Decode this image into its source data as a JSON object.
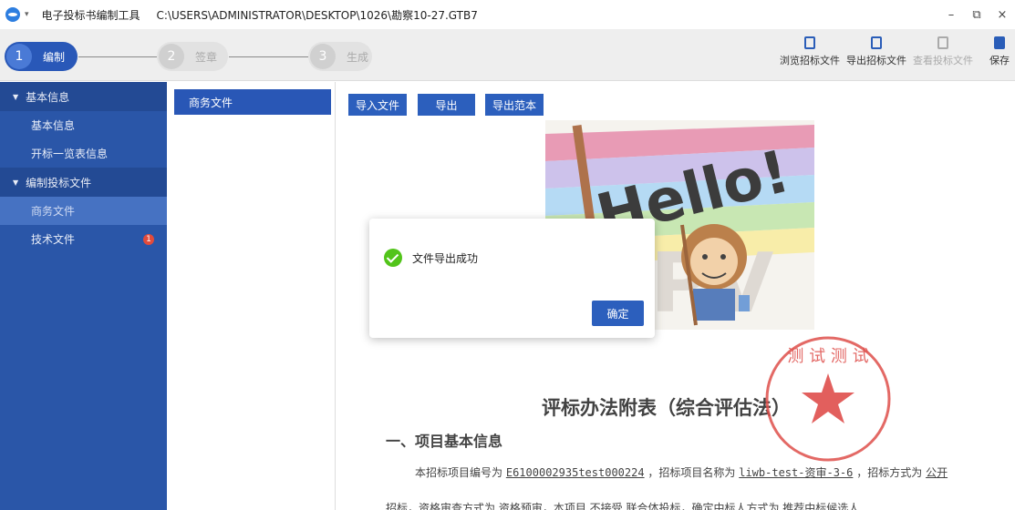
{
  "titlebar": {
    "app_name": "电子投标书编制工具",
    "file_path": "C:\\USERS\\ADMINISTRATOR\\DESKTOP\\1026\\勘察10-27.GTB7",
    "caret": "▾",
    "minimize": "–",
    "restore": "⧉",
    "close": "×"
  },
  "steps": [
    {
      "num": "1",
      "label": "编制"
    },
    {
      "num": "2",
      "label": "签章"
    },
    {
      "num": "3",
      "label": "生成"
    }
  ],
  "tools": {
    "browse": "浏览招标文件",
    "export": "导出招标文件",
    "view": "查看投标文件",
    "save": "保存"
  },
  "sidebar": {
    "groups": [
      {
        "label": "基本信息",
        "items": [
          "基本信息",
          "开标一览表信息"
        ]
      },
      {
        "label": "编制投标文件",
        "items": [
          "商务文件",
          "技术文件"
        ]
      }
    ],
    "badge": "1"
  },
  "file_list": {
    "selected": "商务文件"
  },
  "toolbar": {
    "import": "导入文件",
    "export": "导出",
    "export_sample": "导出范本"
  },
  "image": {
    "text": "Hello!",
    "watermark": "KPV"
  },
  "document": {
    "title": "评标办法附表（综合评估法）",
    "section1": "一、项目基本信息",
    "p1_a": "本招标项目编号为",
    "p1_code": "E6100002935test000224",
    "p1_b": "，招标项目名称为",
    "p1_name": "liwb-test-资审-3-6",
    "p1_c": "，招标方式为",
    "p1_method": "公开",
    "p2": "招标，资格审查方式为 资格预审，本项目 不接受 联合体投标，确定中标人方式为 推荐中标候选人"
  },
  "seal": {
    "text": "测 试 测 试"
  },
  "dialog": {
    "message": "文件导出成功",
    "confirm": "确定"
  },
  "colors": {
    "primary": "#2c5fbd",
    "sidebar": "#2a56a8",
    "success": "#52c41a",
    "seal": "#d9302c"
  }
}
